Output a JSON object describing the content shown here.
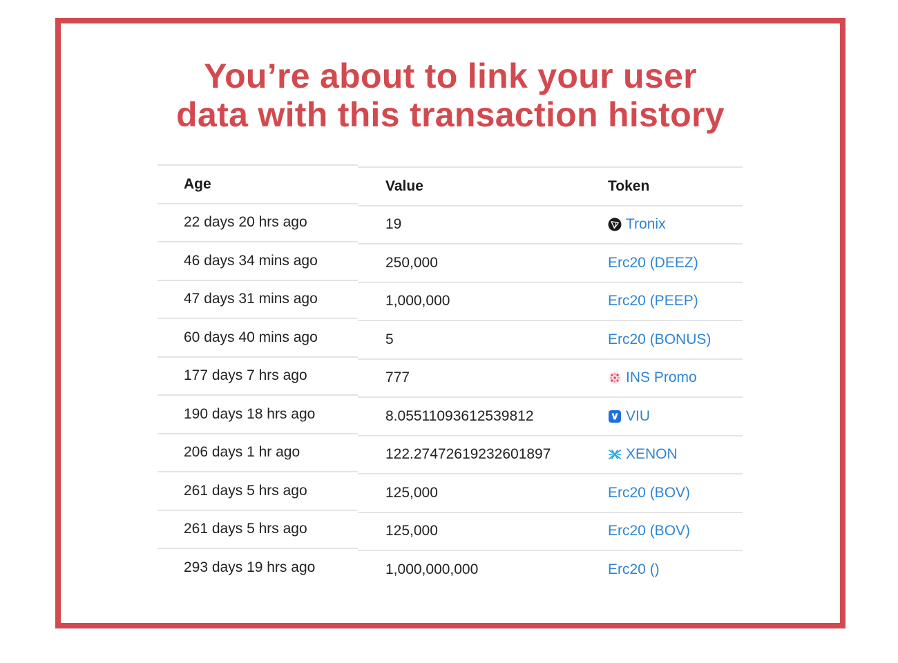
{
  "title": {
    "line1": "You’re about to link your user",
    "line2": "data with this transaction history"
  },
  "colors": {
    "accent": "#d24a4f",
    "link": "#2f84d2",
    "divider": "#e4e4e4"
  },
  "table": {
    "headers": {
      "age": "Age",
      "value": "Value",
      "token": "Token"
    },
    "rows": [
      {
        "age": "22 days 20 hrs ago",
        "value": "19",
        "token": "Tronix",
        "icon": "tronix-icon"
      },
      {
        "age": "46 days 34 mins ago",
        "value": "250,000",
        "token": "Erc20 (DEEZ)",
        "icon": ""
      },
      {
        "age": "47 days 31 mins ago",
        "value": "1,000,000",
        "token": "Erc20 (PEEP)",
        "icon": ""
      },
      {
        "age": "60 days 40 mins ago",
        "value": "5",
        "token": "Erc20 (BONUS)",
        "icon": ""
      },
      {
        "age": "177 days 7 hrs ago",
        "value": "777",
        "token": "INS Promo",
        "icon": "ins-promo-icon"
      },
      {
        "age": "190 days 18 hrs ago",
        "value": "8.05511093612539812",
        "token": "VIU",
        "icon": "viu-icon"
      },
      {
        "age": "206 days 1 hr ago",
        "value": "122.27472619232601897",
        "token": "XENON",
        "icon": "xenon-icon"
      },
      {
        "age": "261 days 5 hrs ago",
        "value": "125,000",
        "token": "Erc20 (BOV)",
        "icon": ""
      },
      {
        "age": "261 days 5 hrs ago",
        "value": "125,000",
        "token": "Erc20 (BOV)",
        "icon": ""
      },
      {
        "age": "293 days 19 hrs ago",
        "value": "1,000,000,000",
        "token": "Erc20 ()",
        "icon": ""
      }
    ]
  }
}
